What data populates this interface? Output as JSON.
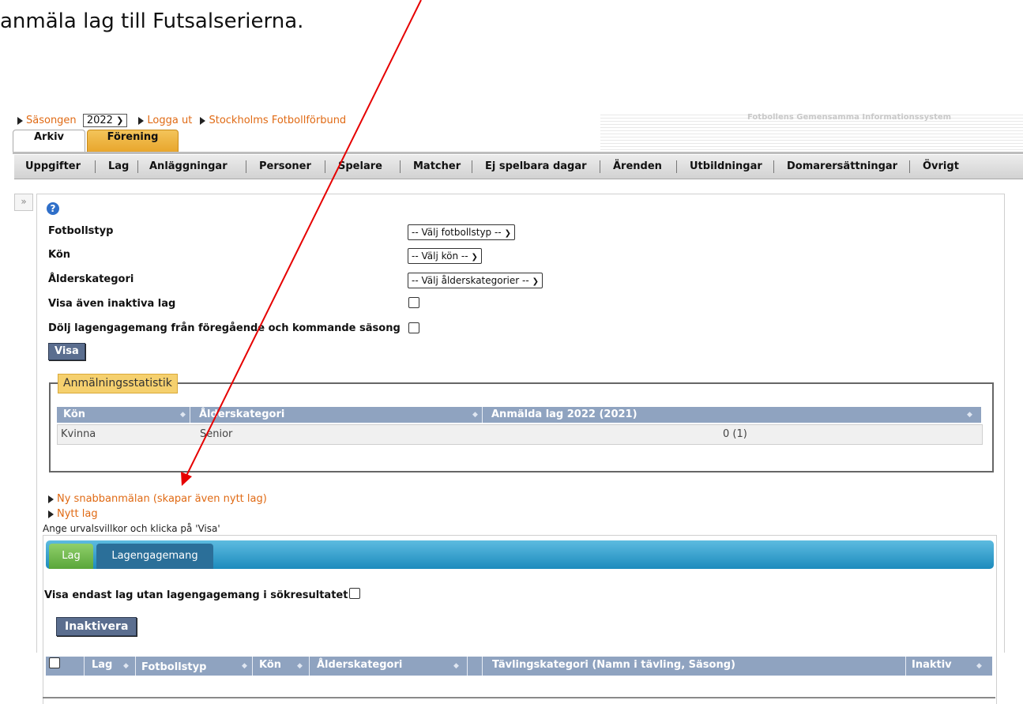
{
  "intro_text": "anmäla lag till Futsalserierna.",
  "header": {
    "season_label": "Säsongen",
    "season_value": "2022",
    "logout_label": "Logga ut",
    "federation_label": "Stockholms Fotbollförbund",
    "system_name": "Fotbollens Gemensamma Informationssystem"
  },
  "top_tabs": [
    "Arkiv",
    "Förening"
  ],
  "menu": [
    "Uppgifter",
    "Lag",
    "Anläggningar",
    "Personer",
    "Spelare",
    "Matcher",
    "Ej spelbara dagar",
    "Ärenden",
    "Utbildningar",
    "Domarersättningar",
    "Övrigt"
  ],
  "collapse_label": "»",
  "help_icon": "?",
  "filters": {
    "fotbollstyp_label": "Fotbollstyp",
    "fotbollstyp_value": "-- Välj fotbollstyp --",
    "kon_label": "Kön",
    "kon_value": "-- Välj kön --",
    "alder_label": "Ålderskategori",
    "alder_value": "-- Välj ålderskategorier --",
    "inaktiva_label": "Visa även inaktiva lag",
    "dolj_label": "Dölj lagengagemang från föregående och kommande säsong",
    "visa_button": "Visa"
  },
  "stats": {
    "legend": "Anmälningsstatistik",
    "headers": [
      "Kön",
      "Ålderskategori",
      "Anmälda lag 2022 (2021)"
    ],
    "rows": [
      [
        "Kvinna",
        "Senior",
        "0 (1)"
      ]
    ]
  },
  "links": {
    "snabb": "Ny snabbanmälan (skapar även nytt lag)",
    "nytt_lag": "Nytt lag"
  },
  "hint": "Ange urvalsvillkor och klicka på 'Visa'",
  "result_tabs": [
    "Lag",
    "Lagengagemang"
  ],
  "visa_endast_label": "Visa endast lag utan lagengagemang i sökresultatet",
  "inaktivera_button": "Inaktivera",
  "result_headers": [
    "Lag",
    "Fotbollstyp",
    "Kön",
    "Ålderskategori",
    "Tävlingskategori (Namn i tävling, Säsong)",
    "Inaktiv"
  ],
  "colors": {
    "orange_link": "#e06a14",
    "table_header": "#8fa3c0",
    "legend_bg": "#f5d06e",
    "arrow": "#e60000"
  },
  "icons": [
    "triangle-bullet-icon",
    "chevron-down-icon",
    "help-icon",
    "double-chevron-right-icon",
    "sort-icon",
    "red-arrow"
  ]
}
